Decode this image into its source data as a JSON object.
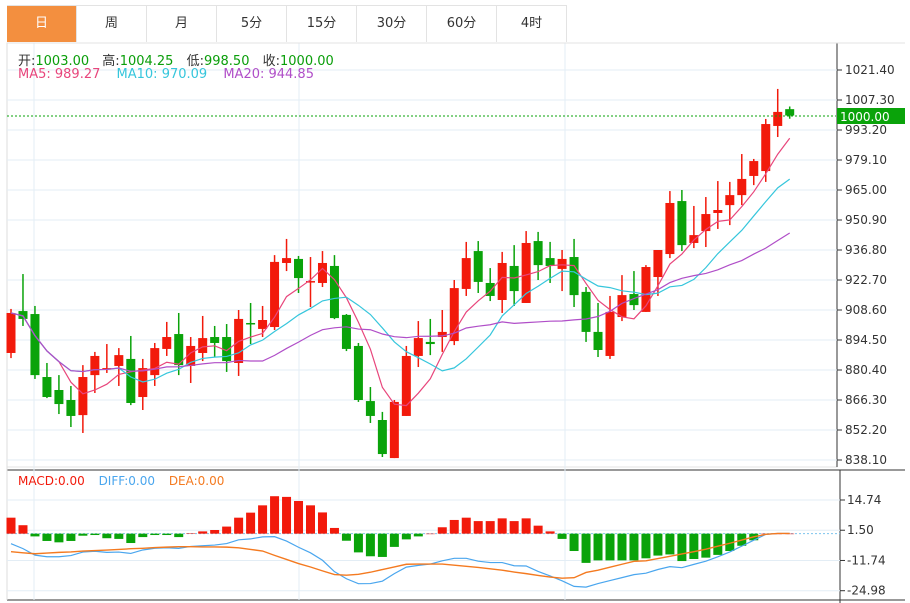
{
  "tabs": [
    {
      "label": "日",
      "active": true
    },
    {
      "label": "周"
    },
    {
      "label": "月"
    },
    {
      "label": "5分"
    },
    {
      "label": "15分"
    },
    {
      "label": "30分"
    },
    {
      "label": "60分"
    },
    {
      "label": "4时"
    }
  ],
  "ohlc_info": {
    "open_label": "开:",
    "open": "1003.00",
    "high_label": "高:",
    "high": "1004.25",
    "low_label": "低:",
    "low": "998.50",
    "close_label": "收:",
    "close": "1000.00"
  },
  "ma_info": {
    "ma5": "MA5: 989.27",
    "ma10": "MA10: 970.09",
    "ma20": "MA20: 944.85"
  },
  "macd_info": {
    "macd": "MACD:0.00",
    "diff": "DIFF:0.00",
    "dea": "DEA:0.00"
  },
  "colors": {
    "up": "#f21a0b",
    "down": "#0aa30a",
    "ma5": "#e8467c",
    "ma10": "#36c6dc",
    "ma20": "#b04ec8",
    "diff": "#4aa6ee",
    "dea": "#f47a20",
    "tab_active": "#f38f3f"
  },
  "current_price": "1000.00",
  "chart_data": [
    {
      "type": "candlestick",
      "price_axis": [
        "1021.40",
        "1007.30",
        "993.20",
        "979.10",
        "965.00",
        "950.90",
        "936.80",
        "922.70",
        "908.60",
        "894.50",
        "880.40",
        "866.30",
        "852.20",
        "838.10"
      ],
      "ylim": [
        838.1,
        1021.4
      ],
      "ma_periods": [
        5,
        10,
        20
      ],
      "candles": [
        [
          888.4,
          909.1,
          886.0,
          907.2
        ],
        [
          908.1,
          925.5,
          901.1,
          904.4
        ],
        [
          906.7,
          910.5,
          876.2,
          878.0
        ],
        [
          877.1,
          883.7,
          867.2,
          867.7
        ],
        [
          871.0,
          878.0,
          859.7,
          864.4
        ],
        [
          866.3,
          872.9,
          853.6,
          858.8
        ],
        [
          859.2,
          882.7,
          850.8,
          877.1
        ],
        [
          878.0,
          888.9,
          869.6,
          887.0
        ],
        [
          880.9,
          892.6,
          879.0,
          881.3
        ],
        [
          882.3,
          890.7,
          872.9,
          887.4
        ],
        [
          885.6,
          896.4,
          863.9,
          864.9
        ],
        [
          867.7,
          885.6,
          861.6,
          881.3
        ],
        [
          878.0,
          893.1,
          872.9,
          890.7
        ],
        [
          890.3,
          903.0,
          887.0,
          895.9
        ],
        [
          897.3,
          907.2,
          878.0,
          882.7
        ],
        [
          882.3,
          895.9,
          874.3,
          891.7
        ],
        [
          888.4,
          905.8,
          884.6,
          895.4
        ],
        [
          895.9,
          901.1,
          886.5,
          893.1
        ],
        [
          895.9,
          902.0,
          879.5,
          884.6
        ],
        [
          883.7,
          908.6,
          877.6,
          904.4
        ],
        [
          902.5,
          911.9,
          892.6,
          902.0
        ],
        [
          899.7,
          910.5,
          895.9,
          903.9
        ],
        [
          900.6,
          934.4,
          899.2,
          931.2
        ],
        [
          930.7,
          942.0,
          926.9,
          933.0
        ],
        [
          932.6,
          934.0,
          916.6,
          923.6
        ],
        [
          921.8,
          933.5,
          910.0,
          922.2
        ],
        [
          921.3,
          936.3,
          919.4,
          930.7
        ],
        [
          929.3,
          934.4,
          904.3,
          904.8
        ],
        [
          906.3,
          906.7,
          889.3,
          890.3
        ],
        [
          891.7,
          893.1,
          865.4,
          866.3
        ],
        [
          865.8,
          872.4,
          855.5,
          858.8
        ],
        [
          856.9,
          860.7,
          839.5,
          840.9
        ],
        [
          839.0,
          866.3,
          839.0,
          865.4
        ],
        [
          858.8,
          891.7,
          858.8,
          887.0
        ],
        [
          887.0,
          903.4,
          881.8,
          895.4
        ],
        [
          893.6,
          904.4,
          887.4,
          892.6
        ],
        [
          895.9,
          908.6,
          888.9,
          898.3
        ],
        [
          894.0,
          922.7,
          892.1,
          918.9
        ],
        [
          918.5,
          940.6,
          915.2,
          933.0
        ],
        [
          936.3,
          941.0,
          916.6,
          921.8
        ],
        [
          921.3,
          928.3,
          912.8,
          915.2
        ],
        [
          913.3,
          935.9,
          907.2,
          930.7
        ],
        [
          929.3,
          939.1,
          910.5,
          917.5
        ],
        [
          911.9,
          945.7,
          911.9,
          940.1
        ],
        [
          941.0,
          945.3,
          922.7,
          929.7
        ],
        [
          933.0,
          940.6,
          921.3,
          929.3
        ],
        [
          927.9,
          936.8,
          917.5,
          932.6
        ],
        [
          933.5,
          942.0,
          910.0,
          915.6
        ],
        [
          917.1,
          919.4,
          893.6,
          898.3
        ],
        [
          898.3,
          911.9,
          886.5,
          889.8
        ],
        [
          887.0,
          915.2,
          885.6,
          907.7
        ],
        [
          905.3,
          925.0,
          903.4,
          915.6
        ],
        [
          916.1,
          926.9,
          908.6,
          910.9
        ],
        [
          907.7,
          929.7,
          907.7,
          928.8
        ],
        [
          924.1,
          936.8,
          915.2,
          936.8
        ],
        [
          934.9,
          964.5,
          933.0,
          958.9
        ],
        [
          959.8,
          965.0,
          936.3,
          939.1
        ],
        [
          940.1,
          957.5,
          937.7,
          943.8
        ],
        [
          945.7,
          961.7,
          938.2,
          953.7
        ],
        [
          954.2,
          969.2,
          946.7,
          955.6
        ],
        [
          957.9,
          968.8,
          948.5,
          962.6
        ],
        [
          962.6,
          981.9,
          957.9,
          970.2
        ],
        [
          971.6,
          979.6,
          967.3,
          978.6
        ],
        [
          973.9,
          998.4,
          968.8,
          996.0
        ],
        [
          995.1,
          1012.5,
          989.9,
          1001.7
        ],
        [
          1003.0,
          1004.25,
          998.5,
          1000.0
        ]
      ]
    },
    {
      "type": "macd",
      "axis": [
        "14.74",
        "1.50",
        "-11.74",
        "-24.98"
      ],
      "ylim": [
        -24.98,
        14.74
      ],
      "macd_hist": [
        7.0,
        3.7,
        -1.2,
        -3.2,
        -3.8,
        -3.2,
        -0.9,
        -0.6,
        -2.0,
        -2.3,
        -4.1,
        -1.5,
        -0.6,
        -0.6,
        -1.5,
        0.2,
        1.0,
        1.6,
        3.1,
        7.0,
        9.2,
        12.4,
        16.4,
        16.1,
        14.3,
        12.4,
        9.3,
        2.5,
        -3.1,
        -8.2,
        -9.9,
        -10.2,
        -5.8,
        -2.5,
        -1.2,
        0,
        2.8,
        6.0,
        7.0,
        5.5,
        5.5,
        6.7,
        5.5,
        6.7,
        3.5,
        1.0,
        -2.3,
        -7.6,
        -12.8,
        -11.7,
        -11.7,
        -11.7,
        -11.7,
        -10.8,
        -9.6,
        -9.1,
        -12.0,
        -11.1,
        -10.5,
        -9.3,
        -7.6,
        -5.3,
        -2.9,
        0,
        0,
        0
      ],
      "dea": [
        -7.9,
        -8.4,
        -8.8,
        -8.5,
        -8.2,
        -8.0,
        -7.6,
        -7.4,
        -7.2,
        -6.9,
        -6.6,
        -6.4,
        -6.1,
        -5.9,
        -5.7,
        -5.7,
        -5.8,
        -5.8,
        -5.9,
        -6.2,
        -6.9,
        -7.6,
        -9.5,
        -11.3,
        -13.1,
        -14.6,
        -16.3,
        -17.9,
        -18.2,
        -17.8,
        -16.9,
        -15.7,
        -14.6,
        -13.4,
        -13.3,
        -13.3,
        -13.3,
        -13.8,
        -14.3,
        -14.8,
        -15.4,
        -16.0,
        -16.8,
        -17.5,
        -18.3,
        -19.0,
        -19.5,
        -19.3,
        -17.0,
        -16.0,
        -14.7,
        -13.4,
        -12.1,
        -11.9,
        -10.9,
        -9.9,
        -8.9,
        -7.9,
        -6.8,
        -5.5,
        -4.2,
        -2.8,
        -1.4,
        -0.3,
        0.1,
        0.1
      ]
    }
  ]
}
